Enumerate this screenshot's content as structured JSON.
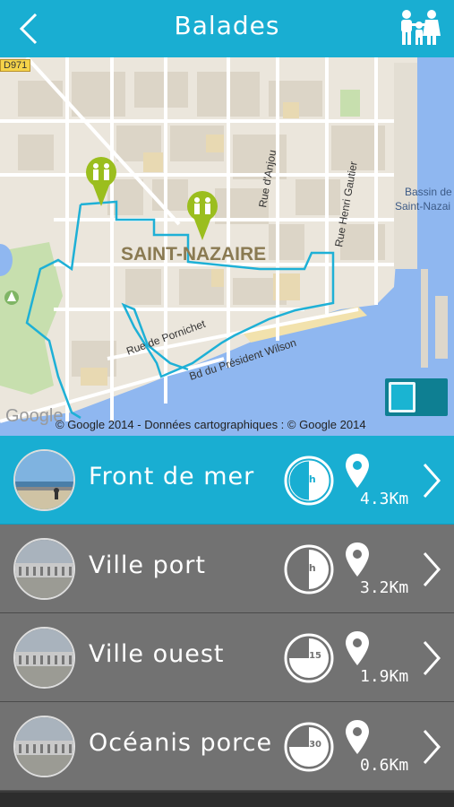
{
  "header": {
    "title": "Balades",
    "back_icon": "chevron-left-icon",
    "family_icon": "family-icon"
  },
  "map": {
    "city_label": "SAINT-NAZAIRE",
    "road_tag": "D971",
    "streets": [
      "Rue d'Anjou",
      "Rue Henri Gautier",
      "Rue de Pornichet",
      "Bd du Président Wilson"
    ],
    "water_label": [
      "Bassin de",
      "Saint-Nazai"
    ],
    "google_logo": "Google",
    "copyright": "© Google 2014 - Données cartographiques : © Google 2014",
    "colors": {
      "route": "#1eb0d6",
      "marker": "#9bbe1e",
      "water": "#8fb7f0",
      "park": "#c7dfae"
    }
  },
  "walks": [
    {
      "name": "Front de mer",
      "duration": "1h",
      "distance": "4.3Km",
      "active": true,
      "filled_fraction": 0.5
    },
    {
      "name": "Ville port",
      "duration": "1h",
      "distance": "3.2Km",
      "active": false,
      "filled_fraction": 0.5
    },
    {
      "name": "Ville ouest",
      "duration": "1h15",
      "distance": "1.9Km",
      "active": false,
      "filled_fraction": 0.625
    },
    {
      "name": "Océanis porce",
      "duration": "1h30",
      "distance": "0.6Km",
      "active": false,
      "filled_fraction": 0.75
    }
  ],
  "colors": {
    "accent": "#19aed2",
    "row_bg": "#727272"
  }
}
